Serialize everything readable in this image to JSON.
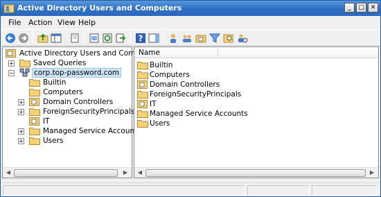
{
  "window": {
    "title": "Active Directory Users and Computers",
    "buttons": {
      "minimize": "_",
      "maximize": "□",
      "close": "✕"
    }
  },
  "menu": [
    "File",
    "Action",
    "View",
    "Help"
  ],
  "toolbar": {
    "icons": [
      "back-arrow-icon",
      "forward-arrow-icon",
      "up-folder-icon",
      "show-tree-icon",
      "copy-icon",
      "properties-icon",
      "refresh-icon",
      "export-list-icon",
      "help-icon",
      "action-pane-icon",
      "new-user-icon",
      "new-group-icon",
      "new-ou-icon",
      "filter-icon",
      "find-icon",
      "add-to-group-icon"
    ]
  },
  "tree": {
    "root": "Active Directory Users and Computers",
    "items": [
      {
        "label": "Saved Queries",
        "expander": "+",
        "level": 1
      },
      {
        "label": "corp.top-password.com",
        "expander": "−",
        "level": 1,
        "selected": true
      },
      {
        "label": "Builtin",
        "expander": "",
        "level": 2
      },
      {
        "label": "Computers",
        "expander": "",
        "level": 2
      },
      {
        "label": "Domain Controllers",
        "expander": "+",
        "level": 2
      },
      {
        "label": "ForeignSecurityPrincipals",
        "expander": "+",
        "level": 2
      },
      {
        "label": "IT",
        "expander": "",
        "level": 2
      },
      {
        "label": "Managed Service Accounts",
        "expander": "+",
        "level": 2
      },
      {
        "label": "Users",
        "expander": "+",
        "level": 2
      }
    ]
  },
  "list": {
    "column": "Name",
    "items": [
      "Builtin",
      "Computers",
      "Domain Controllers",
      "ForeignSecurityPrincipals",
      "IT",
      "Managed Service Accounts",
      "Users"
    ]
  },
  "colors": {
    "title_bar": "#2d6fc3",
    "folder": "#f2d27a",
    "selection": "#cfe3f7"
  }
}
